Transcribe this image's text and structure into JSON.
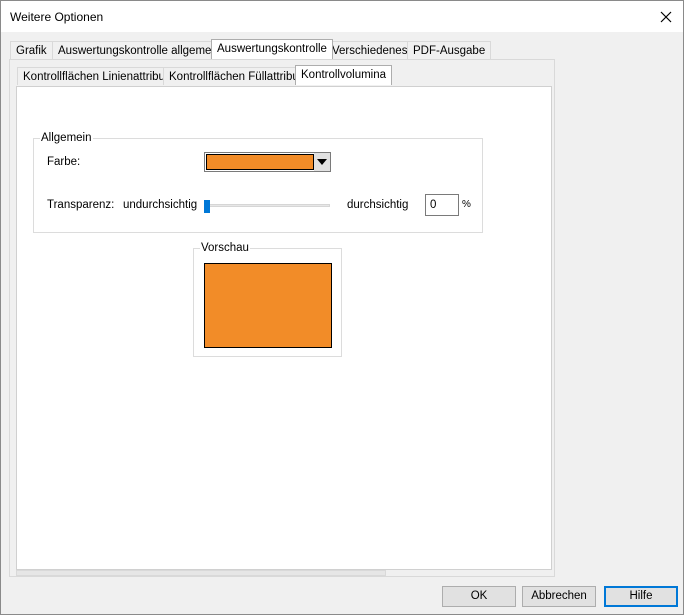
{
  "window": {
    "title": "Weitere Optionen"
  },
  "tabs": {
    "main": [
      {
        "label": "Grafik",
        "active": false
      },
      {
        "label": "Auswertungskontrolle allgemein",
        "active": false
      },
      {
        "label": "Auswertungskontrolle",
        "active": true
      },
      {
        "label": "Verschiedenes",
        "active": false
      },
      {
        "label": "PDF-Ausgabe",
        "active": false
      }
    ],
    "sub": [
      {
        "label": "Kontrollflächen Linienattribut",
        "active": false
      },
      {
        "label": "Kontrollflächen Füllattribut",
        "active": false
      },
      {
        "label": "Kontrollvolumina",
        "active": true
      }
    ]
  },
  "general": {
    "legend": "Allgemein",
    "color_label": "Farbe:",
    "color_value": "#f28c28",
    "transparency_label": "Transparenz:",
    "opaque_label": "undurchsichtig",
    "transparent_label": "durchsichtig",
    "transparency_value": "0",
    "transparency_fraction": 0,
    "percent_symbol": "%"
  },
  "preview": {
    "legend": "Vorschau",
    "fill_color": "#f28c28"
  },
  "buttons": {
    "ok": "OK",
    "cancel": "Abbrechen",
    "help": "Hilfe"
  },
  "colors": {
    "accent": "#0078d7",
    "swatch": "#f28c28"
  }
}
